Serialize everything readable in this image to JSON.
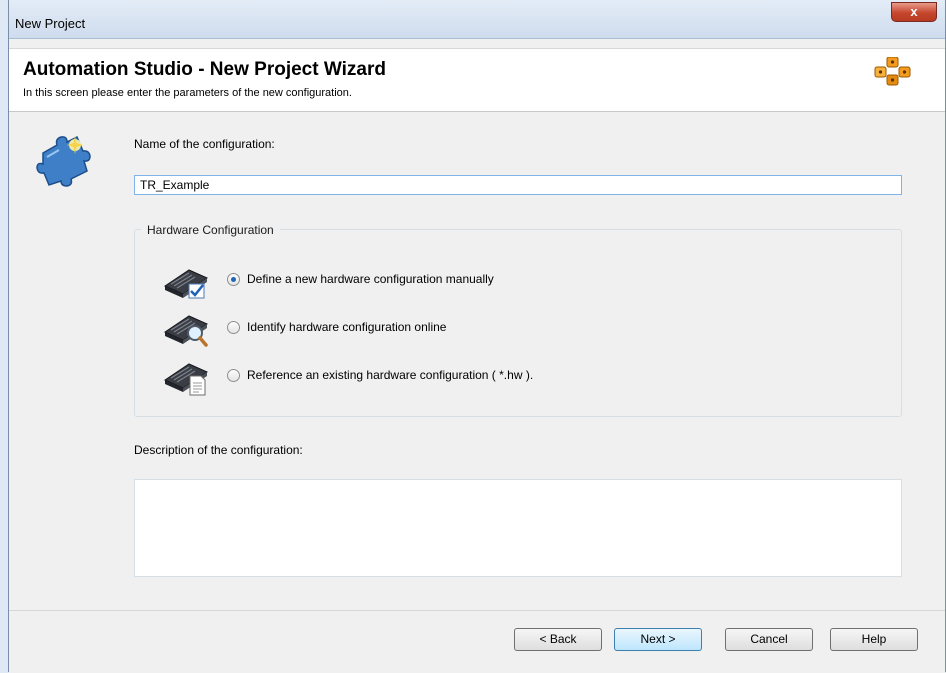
{
  "window": {
    "title": "New Project",
    "close_label": "x"
  },
  "header": {
    "title": "Automation Studio - New Project Wizard",
    "subtitle": "In this screen please enter the parameters of the new configuration."
  },
  "form": {
    "name_label": "Name of the configuration:",
    "name_value": "TR_Example",
    "hardware_group_title": "Hardware Configuration",
    "options": [
      {
        "label": "Define a new hardware configuration manually",
        "icon": "hardware-checkmark-icon",
        "selected": true
      },
      {
        "label": "Identify hardware configuration online",
        "icon": "hardware-magnifier-icon",
        "selected": false
      },
      {
        "label": "Reference an existing hardware configuration ( *.hw ).",
        "icon": "hardware-document-icon",
        "selected": false
      }
    ],
    "description_label": "Description of the configuration:",
    "description_value": ""
  },
  "buttons": {
    "back": "< Back",
    "next": "Next >",
    "cancel": "Cancel",
    "help": "Help"
  },
  "colors": {
    "accent": "#2166b6",
    "logo_orange": "#f39a1f",
    "input_border": "#7eb4ea"
  }
}
